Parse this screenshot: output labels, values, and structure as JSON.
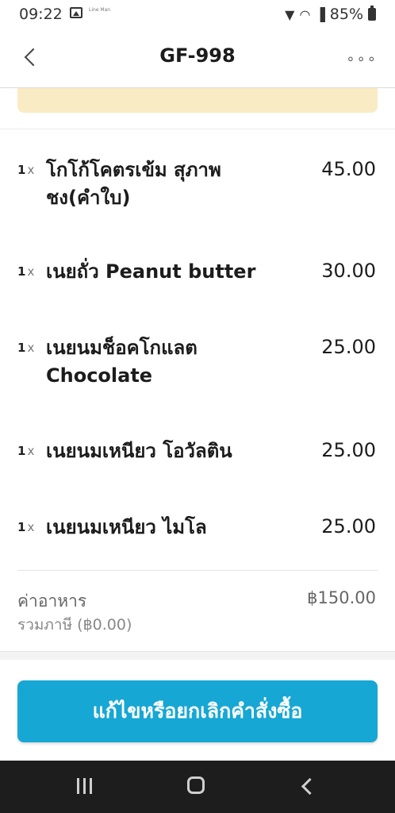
{
  "status_bar": {
    "time": "09:22",
    "tiny_text": "Line Man",
    "battery": "85%"
  },
  "header": {
    "title": "GF-998",
    "more": "∘∘∘"
  },
  "items": [
    {
      "qty": "1",
      "x": "x",
      "name": "โกโก้โคตรเข้ม สุภาพ ชง(คำใบ)",
      "price": "45.00"
    },
    {
      "qty": "1",
      "x": "x",
      "name": "เนยถั่ว Peanut butter",
      "price": "30.00"
    },
    {
      "qty": "1",
      "x": "x",
      "name": "เนยนมช็อคโกแลต Chocolate",
      "price": "25.00"
    },
    {
      "qty": "1",
      "x": "x",
      "name": "เนยนมเหนียว โอวัลติน",
      "price": "25.00"
    },
    {
      "qty": "1",
      "x": "x",
      "name": "เนยนมเหนียว ไมโล",
      "price": "25.00"
    }
  ],
  "summary": {
    "label": "ค่าอาหาร",
    "tax_note": "รวมภาษี (฿0.00)",
    "total": "฿150.00"
  },
  "cta": {
    "label": "แก้ไขหรือยกเลิกคำสั่งซื้อ"
  },
  "colors": {
    "primary": "#17a7d4",
    "banner": "#f9ebc3",
    "navbar": "#1d1d1d"
  }
}
